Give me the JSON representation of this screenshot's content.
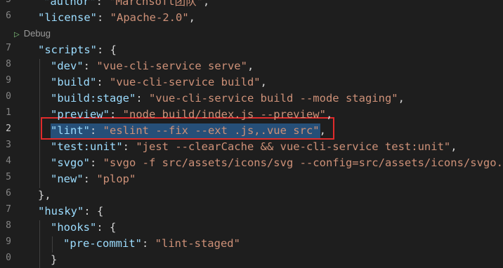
{
  "line_numbers": [
    "5",
    "6",
    "7",
    "8",
    "9",
    "0",
    "1",
    "2",
    "3",
    "4",
    "5",
    "6",
    "7",
    "8",
    "9",
    "0"
  ],
  "active_line_number": "2",
  "codelens": {
    "label": "Debug"
  },
  "lines": {
    "author": {
      "key": "\"author\"",
      "colon": ": ",
      "value": "\"Marchsoft团队\"",
      "tail": ","
    },
    "license": {
      "key": "\"license\"",
      "colon": ": ",
      "value": "\"Apache-2.0\"",
      "tail": ","
    },
    "scripts": {
      "key": "\"scripts\"",
      "colon": ": ",
      "tail": "{"
    },
    "dev": {
      "key": "\"dev\"",
      "colon": ": ",
      "value": "\"vue-cli-service serve\"",
      "tail": ","
    },
    "build": {
      "key": "\"build\"",
      "colon": ": ",
      "value": "\"vue-cli-service build\"",
      "tail": ","
    },
    "build_stage": {
      "key": "\"build:stage\"",
      "colon": ": ",
      "value": "\"vue-cli-service build --mode staging\"",
      "tail": ","
    },
    "preview": {
      "key": "\"preview\"",
      "colon": ": ",
      "value": "\"node build/index.js --preview\"",
      "tail": ","
    },
    "lint": {
      "key": "\"lint\"",
      "colon": ": ",
      "value": "\"eslint --fix --ext .js,.vue src\"",
      "tail": ","
    },
    "test_unit": {
      "key": "\"test:unit\"",
      "colon": ": ",
      "value": "\"jest --clearCache && vue-cli-service test:unit\"",
      "tail": ","
    },
    "svgo": {
      "key": "\"svgo\"",
      "colon": ": ",
      "value": "\"svgo -f src/assets/icons/svg --config=src/assets/icons/svgo.y",
      "tail": ""
    },
    "new": {
      "key": "\"new\"",
      "colon": ": ",
      "value": "\"plop\""
    },
    "scripts_close": {
      "text": "},"
    },
    "husky": {
      "key": "\"husky\"",
      "colon": ": ",
      "tail": "{"
    },
    "hooks": {
      "key": "\"hooks\"",
      "colon": ": ",
      "tail": "{"
    },
    "pre_commit": {
      "key": "\"pre-commit\"",
      "colon": ": ",
      "value": "\"lint-staged\""
    },
    "hooks_close": {
      "text": "}"
    }
  },
  "colors": {
    "background": "#1e1e1e",
    "json_key": "#9cdcfe",
    "json_string": "#ce9178",
    "punctuation": "#d4d4d4",
    "selection": "#264f78",
    "annotation_box": "#e02b2b"
  }
}
